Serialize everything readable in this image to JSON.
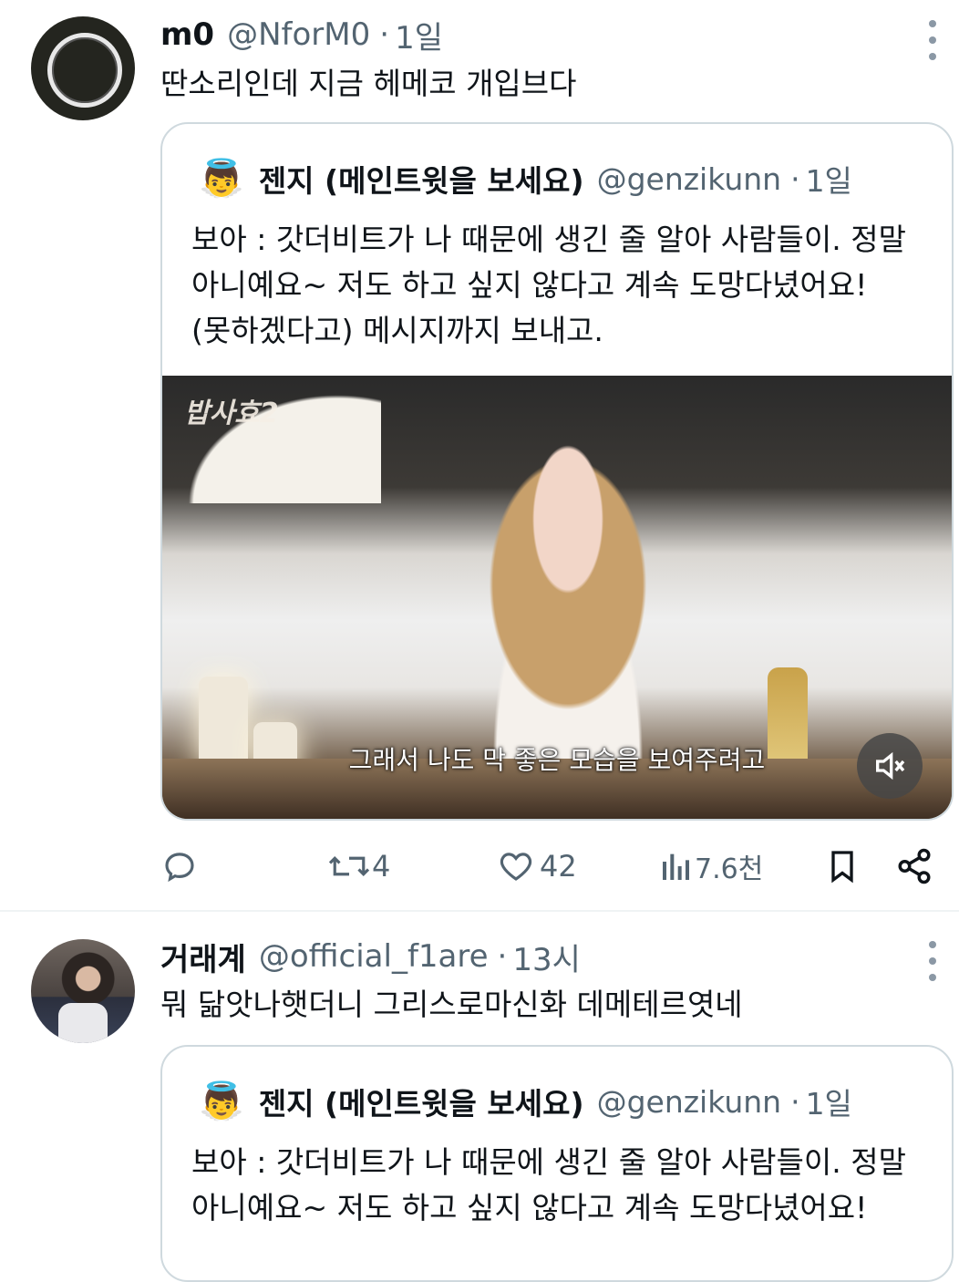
{
  "tweets": [
    {
      "author": "m0",
      "handle": "@NforM0",
      "time": "1일",
      "text": "딴소리인데 지금 헤메코 개입브다",
      "quote": {
        "emoji": "👼",
        "author": "젠지 (메인트윗을 보세요)",
        "handle": "@genzikunn",
        "time": "1일",
        "lines": [
          "보아 : 갓더비트가 나 때문에 생긴 줄 알아 사람들이. 정말",
          "아니예요~ 저도 하고 싶지 않다고 계속 도망다녔어요!",
          "(못하겠다고) 메시지까지 보내고."
        ],
        "media": {
          "logo": "밥사효2",
          "caption": "그래서 나도 막 좋은 모습을 보여주려고"
        }
      },
      "actions": {
        "reply_count": "",
        "retweet_count": "4",
        "like_count": "42",
        "view_count": "7.6천"
      }
    },
    {
      "author": "거래계",
      "handle": "@official_f1are",
      "time": "13시",
      "text": "뭐 닮앗나햇더니 그리스로마신화 데메테르엿네",
      "quote": {
        "emoji": "👼",
        "author": "젠지 (메인트윗을 보세요)",
        "handle": "@genzikunn",
        "time": "1일",
        "lines": [
          "보아 : 갓더비트가 나 때문에 생긴 줄 알아 사람들이. 정말",
          "아니예요~ 저도 하고 싶지 않다고 계속 도망다녔어요!"
        ]
      }
    }
  ],
  "separator": "·",
  "icons": {
    "more": "more-vertical-icon",
    "reply": "reply-icon",
    "retweet": "retweet-icon",
    "like": "heart-icon",
    "views": "views-icon",
    "bookmark": "bookmark-icon",
    "share": "share-icon",
    "mute": "volume-mute-icon"
  },
  "colors": {
    "text": "#0f1419",
    "secondary": "#536471",
    "border": "#cfd9de"
  }
}
